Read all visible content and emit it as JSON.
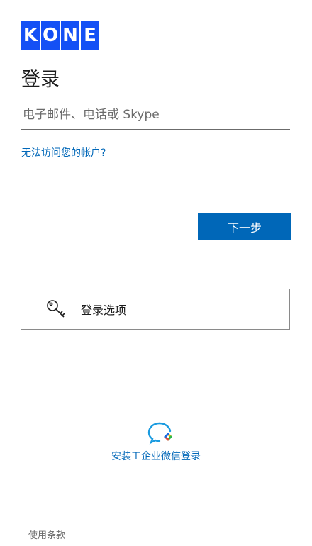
{
  "brand": {
    "letters": [
      "K",
      "O",
      "N",
      "E"
    ],
    "color": "#1450f5"
  },
  "page": {
    "title": "登录"
  },
  "login": {
    "placeholder": "电子邮件、电话或 Skype",
    "cant_access": "无法访问您的帐户?",
    "next": "下一步"
  },
  "options": {
    "label": "登录选项",
    "icon": "key-icon"
  },
  "wechat": {
    "label": "安装工企业微信登录",
    "icon": "chat-bubble-icon"
  },
  "footer": {
    "terms": "使用条款"
  },
  "colors": {
    "accent": "#0067b8",
    "text": "#1b1b1b",
    "muted": "#6b6b6b"
  }
}
